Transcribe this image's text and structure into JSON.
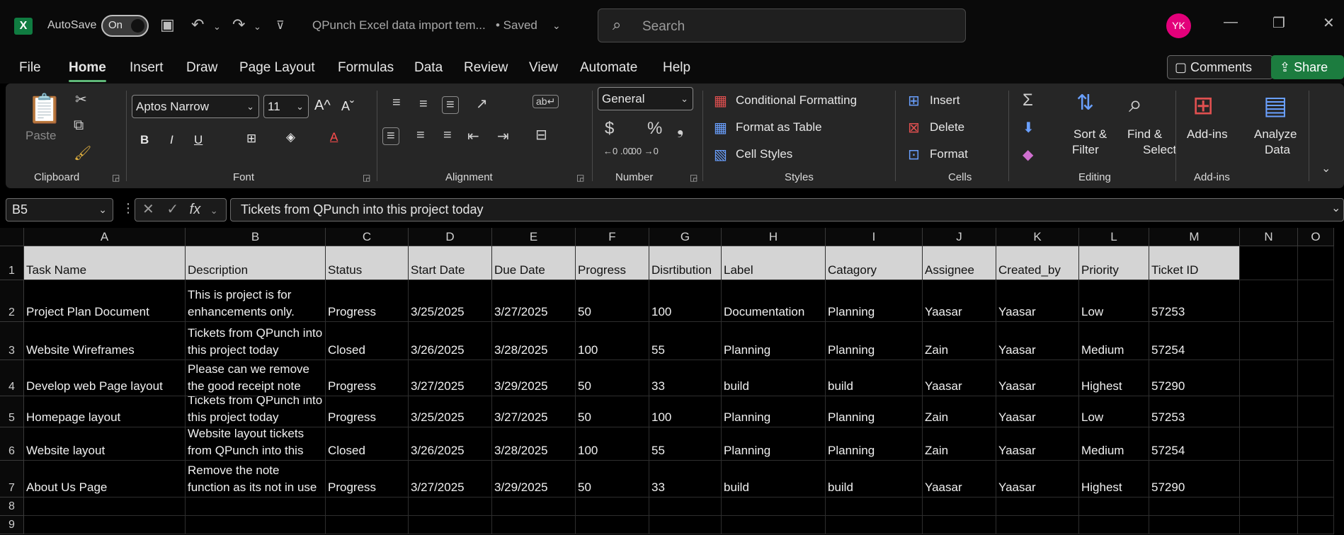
{
  "titlebar": {
    "autosave_label": "AutoSave",
    "autosave_state": "On",
    "doc_title": "QPunch Excel data import tem...",
    "saved_status": "• Saved",
    "search_placeholder": "Search",
    "avatar_initials": "YK"
  },
  "menu": {
    "tabs": [
      "File",
      "Home",
      "Insert",
      "Draw",
      "Page Layout",
      "Formulas",
      "Data",
      "Review",
      "View",
      "Automate",
      "Help"
    ],
    "active_tab": "Home",
    "comments_label": "Comments",
    "share_label": "Share"
  },
  "ribbon": {
    "clipboard": {
      "label": "Clipboard",
      "paste_label": "Paste"
    },
    "font": {
      "label": "Font",
      "font_name": "Aptos Narrow",
      "font_size": "11"
    },
    "alignment": {
      "label": "Alignment"
    },
    "number": {
      "label": "Number",
      "format": "General"
    },
    "styles": {
      "label": "Styles",
      "conditional": "Conditional Formatting",
      "format_table": "Format as Table",
      "cell_styles": "Cell Styles"
    },
    "cells": {
      "label": "Cells",
      "insert": "Insert",
      "delete": "Delete",
      "format": "Format"
    },
    "editing": {
      "label": "Editing",
      "sort_filter_1": "Sort &",
      "sort_filter_2": "Filter",
      "find_select_1": "Find &",
      "find_select_2": "Select"
    },
    "addins": {
      "label": "Add-ins",
      "addins_btn": "Add-ins",
      "analyze_1": "Analyze",
      "analyze_2": "Data"
    }
  },
  "formula_bar": {
    "name_box": "B5",
    "content": "Tickets from QPunch into this project today"
  },
  "sheet": {
    "columns": [
      "A",
      "B",
      "C",
      "D",
      "E",
      "F",
      "G",
      "H",
      "I",
      "J",
      "K",
      "L",
      "M",
      "N",
      "O"
    ],
    "row_numbers": [
      "1",
      "2",
      "3",
      "4",
      "5",
      "6",
      "7",
      "8",
      "9"
    ],
    "header_row": [
      "Task Name",
      "Description",
      "Status",
      "Start Date",
      "Due Date",
      "Progress",
      "Disrtibution",
      "Label",
      "Catagory",
      "Assignee",
      "Created_by",
      "Priority",
      "Ticket ID"
    ],
    "rows": [
      [
        "Project Plan Document",
        "This is project is for enhancements only.",
        "Progress",
        "3/25/2025",
        "3/27/2025",
        "50",
        "100",
        "Documentation",
        "Planning",
        "Yaasar",
        "Yaasar",
        "Low",
        "57253"
      ],
      [
        "Website Wireframes",
        "Tickets from QPunch into this project today",
        "Closed",
        "3/26/2025",
        "3/28/2025",
        "100",
        "55",
        "Planning",
        "Planning",
        "Zain",
        "Yaasar",
        "Medium",
        "57254"
      ],
      [
        "Develop web Page layout",
        "Please can we remove the good receipt note",
        "Progress",
        "3/27/2025",
        "3/29/2025",
        "50",
        "33",
        "build",
        "build",
        "Yaasar",
        "Yaasar",
        "Highest",
        "57290"
      ],
      [
        "Homepage layout",
        "Tickets from QPunch into this project today",
        "Progress",
        "3/25/2025",
        "3/27/2025",
        "50",
        "100",
        "Planning",
        "Planning",
        "Zain",
        "Yaasar",
        "Low",
        "57253"
      ],
      [
        "Website layout",
        "Website layout tickets from QPunch into this",
        "Closed",
        "3/26/2025",
        "3/28/2025",
        "100",
        "55",
        "Planning",
        "Planning",
        "Zain",
        "Yaasar",
        "Medium",
        "57254"
      ],
      [
        "About Us Page",
        " Remove the note function as its not in use",
        "Progress",
        "3/27/2025",
        "3/29/2025",
        "50",
        "33",
        "build",
        "build",
        "Yaasar",
        "Yaasar",
        "Highest",
        "57290"
      ]
    ]
  }
}
